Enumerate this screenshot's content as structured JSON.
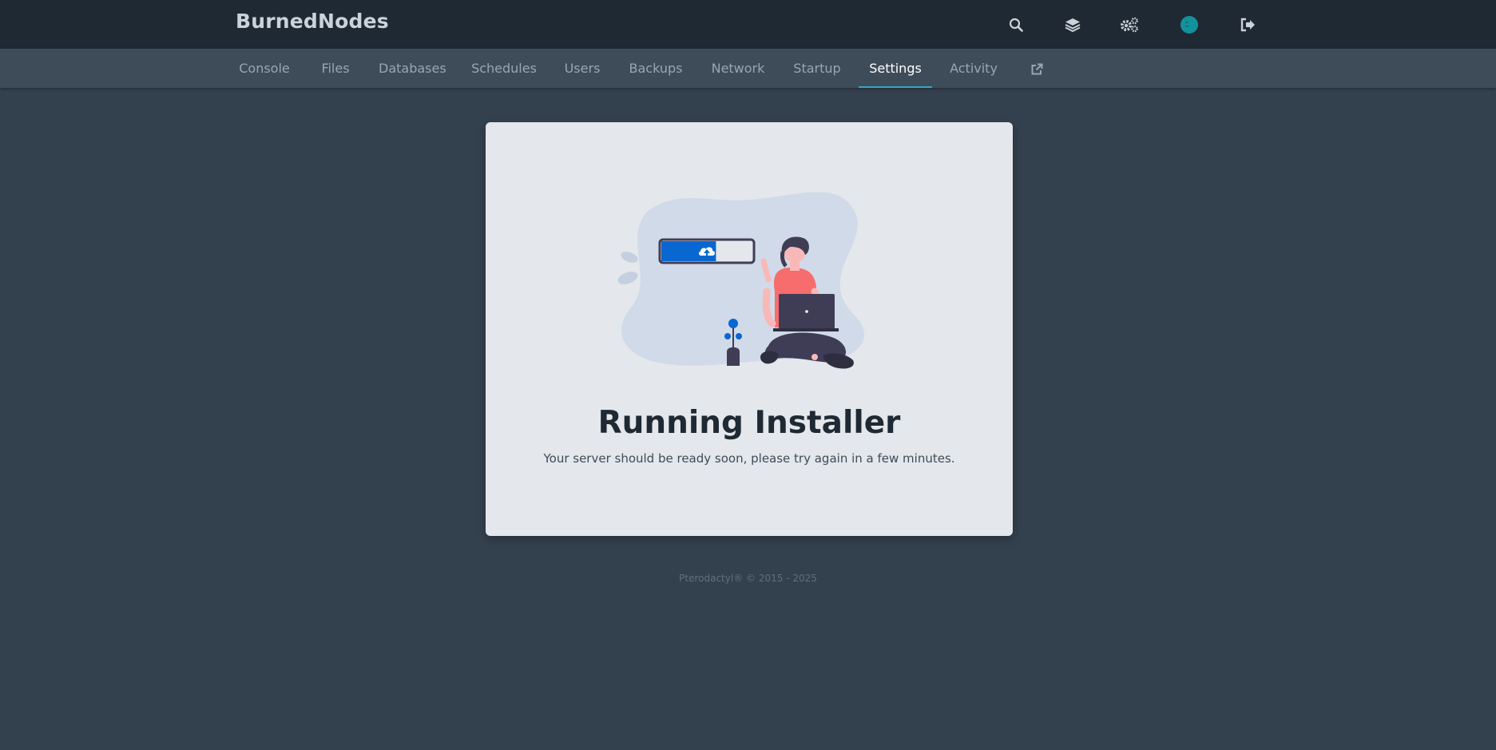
{
  "header": {
    "brand": "BurnedNodes",
    "icons": [
      "search-icon",
      "layers-icon",
      "gears-icon",
      "avatar",
      "sign-out-icon"
    ]
  },
  "nav": {
    "tabs": [
      {
        "label": "Console"
      },
      {
        "label": "Files"
      },
      {
        "label": "Databases"
      },
      {
        "label": "Schedules"
      },
      {
        "label": "Users"
      },
      {
        "label": "Backups"
      },
      {
        "label": "Network"
      },
      {
        "label": "Startup"
      },
      {
        "label": "Settings",
        "active": true
      },
      {
        "label": "Activity"
      }
    ],
    "external_icon": "external-link-icon"
  },
  "installer": {
    "title": "Running Installer",
    "message": "Your server should be ready soon, please try again in a few minutes.",
    "progress_fraction": 0.6
  },
  "footer": {
    "text": "Pterodactyl® © 2015 - 2025"
  },
  "colors": {
    "topbar": "#1f2933",
    "subnav": "#3e4c59",
    "background": "#33404d",
    "active_tab_underline": "#32a7c1",
    "card": "#e4e7eb",
    "progress": "#0967d2",
    "avatar": "#14919b"
  }
}
